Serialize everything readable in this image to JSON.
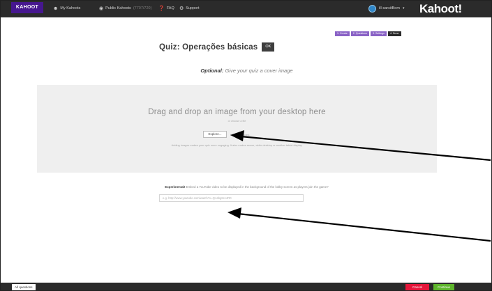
{
  "header": {
    "brand": "KAHOOT",
    "nav": [
      {
        "label": "My Kahoots",
        "icon": "user-icon"
      },
      {
        "label": "Public Kahoots",
        "sub": "(7707/720)",
        "icon": "globe-icon"
      },
      {
        "label": "FAQ",
        "icon": "question-icon"
      },
      {
        "label": "Support",
        "icon": "support-icon"
      }
    ],
    "user": "ill-sarsitBom",
    "logo": "Kahoot!"
  },
  "steps": [
    "1. Create",
    "2. Questions",
    "3. Settings",
    "4. Done"
  ],
  "quiz": {
    "title": "Quiz: Operações básicas",
    "ok_label": "OK"
  },
  "cover": {
    "prompt_bold": "Optional:",
    "prompt_text": "Give your quiz a cover image"
  },
  "dropzone": {
    "heading": "Drag and drop an image from your desktop here",
    "or": "or choose a file",
    "browse_label": "Explore...",
    "browse_note": "No file selected.",
    "help": "Adding images makes your quiz more engaging. It also makes sense, while desktop or another tablet display."
  },
  "experimental": {
    "label": "Experimental!",
    "text": "Embed a YouTube video to be displayed in the background of the lobby screen as players join the game?",
    "placeholder": "e.g. http://www.youtube.com/watch?v=QAsbg8cc4R0"
  },
  "footer": {
    "all_questions": "All questions",
    "cancel": "Cancel",
    "continue": "Continue"
  },
  "colors": {
    "header_bg": "#2b2b2b",
    "brand": "#46178f",
    "step": "#8a63c6",
    "cancel": "#e5163a",
    "continue": "#5eb52c"
  }
}
